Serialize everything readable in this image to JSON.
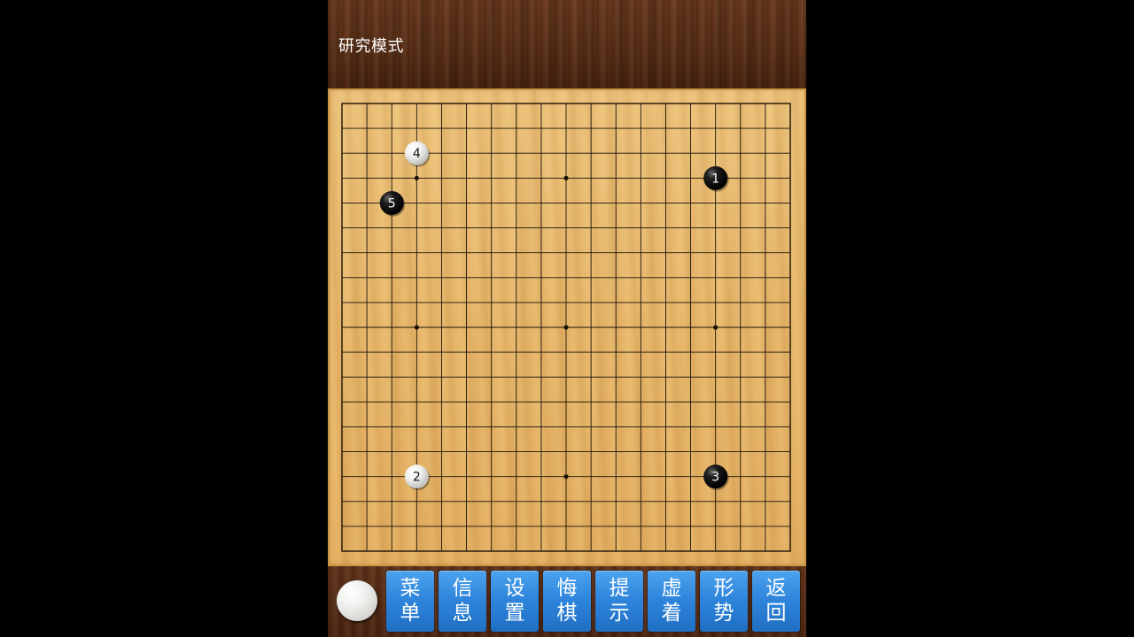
{
  "header": {
    "title": "研究模式"
  },
  "board": {
    "size": 19,
    "line_color": "#1a1208",
    "star_points": [
      [
        3,
        3
      ],
      [
        9,
        3
      ],
      [
        15,
        3
      ],
      [
        3,
        9
      ],
      [
        9,
        9
      ],
      [
        15,
        9
      ],
      [
        3,
        15
      ],
      [
        9,
        15
      ],
      [
        15,
        15
      ]
    ],
    "stones": [
      {
        "color": "black",
        "col": 15,
        "row": 3,
        "label": "1"
      },
      {
        "color": "white",
        "col": 3,
        "row": 15,
        "label": "2"
      },
      {
        "color": "black",
        "col": 15,
        "row": 15,
        "label": "3"
      },
      {
        "color": "white",
        "col": 3,
        "row": 2,
        "label": "4"
      },
      {
        "color": "black",
        "col": 2,
        "row": 4,
        "label": "5"
      }
    ]
  },
  "toolbar": {
    "turn_indicator": "white",
    "buttons": [
      {
        "id": "menu",
        "line1": "菜",
        "line2": "单"
      },
      {
        "id": "info",
        "line1": "信",
        "line2": "息"
      },
      {
        "id": "settings",
        "line1": "设",
        "line2": "置"
      },
      {
        "id": "undo",
        "line1": "悔",
        "line2": "棋"
      },
      {
        "id": "hint",
        "line1": "提",
        "line2": "示"
      },
      {
        "id": "pass",
        "line1": "虚",
        "line2": "着"
      },
      {
        "id": "situation",
        "line1": "形",
        "line2": "势"
      },
      {
        "id": "back",
        "line1": "返",
        "line2": "回"
      }
    ]
  },
  "colors": {
    "button_blue": "#2f86dc",
    "board_wood": "#e8b86c",
    "frame_wood": "#5a2f16"
  }
}
